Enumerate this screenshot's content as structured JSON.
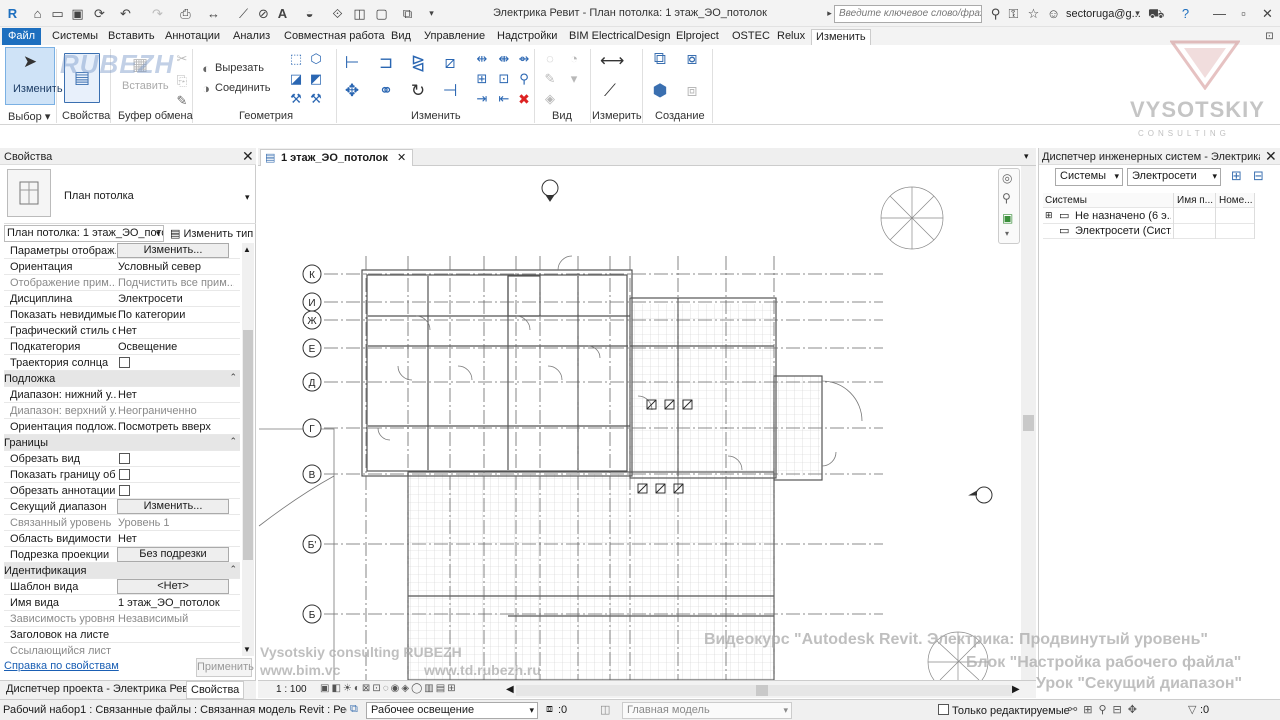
{
  "window": {
    "title": "Электрика Ревит - План потолка: 1 этаж_ЭО_потолок",
    "search_placeholder": "Введите ключевое слово/фразу",
    "user": "sectoruga@g..."
  },
  "menu": {
    "file": "Файл",
    "tabs": [
      "Системы",
      "Вставить",
      "Аннотации",
      "Анализ",
      "Совместная работа",
      "Вид",
      "Управление",
      "Надстройки",
      "BIM ElectricalDesign",
      "Elproject",
      "OSTEC",
      "Relux",
      "Изменить"
    ]
  },
  "ribbon": {
    "modify_label": "Изменить",
    "insert_label": "Вставить",
    "cut_label": "Вырезать",
    "join_label": "Соединить",
    "panels": [
      "Выбор",
      "Свойства",
      "Буфер обмена",
      "Геометрия",
      "Изменить",
      "Вид",
      "Измерить",
      "Создание"
    ],
    "properties_label": "Свойства"
  },
  "properties": {
    "title": "Свойства",
    "type_name": "План потолка",
    "instance_select": "План потолка: 1 этаж_ЭО_потол",
    "edit_type": "Изменить тип",
    "rows": [
      {
        "name": "Параметры отображ...",
        "button": "Изменить..."
      },
      {
        "name": "Ориентация",
        "value": "Условный север"
      },
      {
        "name": "Отображение прим...",
        "value": "Подчистить все прим...",
        "grey": true
      },
      {
        "name": "Дисциплина",
        "value": "Электросети"
      },
      {
        "name": "Показать невидимые...",
        "value": "По категории"
      },
      {
        "name": "Графический стиль о...",
        "value": "Нет"
      },
      {
        "name": "Подкатегория",
        "value": "Освещение"
      },
      {
        "name": "Траектория солнца",
        "checkbox": true
      },
      {
        "group": "Подложка"
      },
      {
        "name": "Диапазон: нижний у...",
        "value": "Нет"
      },
      {
        "name": "Диапазон: верхний у...",
        "value": "Неограниченно",
        "grey": true
      },
      {
        "name": "Ориентация подлож...",
        "value": "Посмотреть вверх"
      },
      {
        "group": "Границы"
      },
      {
        "name": "Обрезать вид",
        "checkbox": true
      },
      {
        "name": "Показать границу об...",
        "checkbox": true
      },
      {
        "name": "Обрезать аннотации",
        "checkbox": true
      },
      {
        "name": "Секущий диапазон",
        "button": "Изменить..."
      },
      {
        "name": "Связанный уровень",
        "value": "Уровень 1",
        "grey": true
      },
      {
        "name": "Область видимости",
        "value": "Нет"
      },
      {
        "name": "Подрезка проекции",
        "button": "Без подрезки"
      },
      {
        "group": "Идентификация"
      },
      {
        "name": "Шаблон вида",
        "button": "<Нет>"
      },
      {
        "name": "Имя вида",
        "value": "1 этаж_ЭО_потолок"
      },
      {
        "name": "Зависимость уровня",
        "value": "Независимый",
        "grey": true
      },
      {
        "name": "Заголовок на листе",
        "value": ""
      },
      {
        "name": "Ссылающийся лист",
        "value": "",
        "grey": true
      }
    ],
    "help_link": "Справка по свойствам",
    "apply": "Применить"
  },
  "left_tabs": [
    "Диспетчер проекта - Электрика Ревит",
    "Свойства"
  ],
  "view": {
    "tab_title": "1 этаж_ЭО_потолок",
    "scale": "1 : 100",
    "grid_labels": [
      "К",
      "И",
      "Ж",
      "Е",
      "Д",
      "Г",
      "В",
      "Б'",
      "Б"
    ]
  },
  "system_manager": {
    "title": "Диспетчер инженерных систем - Электрика Р...",
    "filter1": "Системы",
    "filter2": "Электросети",
    "columns": [
      "Системы",
      "Имя п...",
      "Номе..."
    ],
    "rows": [
      "Не назначено (6 э...",
      "Электросети (Сист..."
    ]
  },
  "status": {
    "text": "Рабочий набор1 : Связанные файлы : Связанная модель Revit : Ресторан.r",
    "workset": "Рабочее освещение",
    "counter": ":0",
    "main_model": "Главная модель",
    "only_edit": "Только редактируемые",
    "filter_count": ":0"
  },
  "overlays": {
    "logo": "RUBEZH",
    "brand": "VYSOTSKIY",
    "brand_sub": "CONSULTING",
    "credit1": "Vysotskiy consulting  RUBEZH",
    "credit2": "www.bim.vc",
    "credit3": "www.td.rubezh.ru",
    "course1": "Видеокурс \"Autodesk Revit. Электрика: Продвинутый уровень\"",
    "course2": "Блок \"Настройка рабочего файла\"",
    "course3": "Урок \"Секущий диапазон\""
  },
  "colors": {
    "accent": "#1d6fbf",
    "panel_bg": "#f0f0f0"
  }
}
